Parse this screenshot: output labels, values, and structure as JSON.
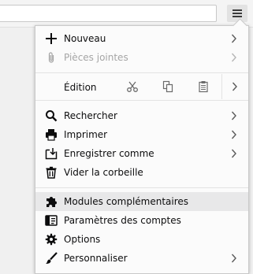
{
  "menu": {
    "new": {
      "label": "Nouveau",
      "icon": "plus-icon"
    },
    "attachments": {
      "label": "Pièces jointes",
      "icon": "paperclip-icon"
    },
    "edit": {
      "label": "Édition",
      "cut_icon": "scissors-icon",
      "copy_icon": "copy-icon",
      "paste_icon": "clipboard-icon"
    },
    "search": {
      "label": "Rechercher",
      "icon": "magnifier-icon"
    },
    "print": {
      "label": "Imprimer",
      "icon": "printer-icon"
    },
    "save_as": {
      "label": "Enregistrer comme",
      "icon": "save-icon"
    },
    "empty_trash": {
      "label": "Vider la corbeille",
      "icon": "trash-icon"
    },
    "addons": {
      "label": "Modules complémentaires",
      "icon": "puzzle-icon"
    },
    "account_settings": {
      "label": "Paramètres des comptes",
      "icon": "account-icon"
    },
    "options": {
      "label": "Options",
      "icon": "gear-icon"
    },
    "customize": {
      "label": "Personnaliser",
      "icon": "brush-icon"
    }
  },
  "colors": {
    "text": "#0c0c0d",
    "disabled": "#a5a5a5",
    "hover": "#e8e8e9"
  }
}
